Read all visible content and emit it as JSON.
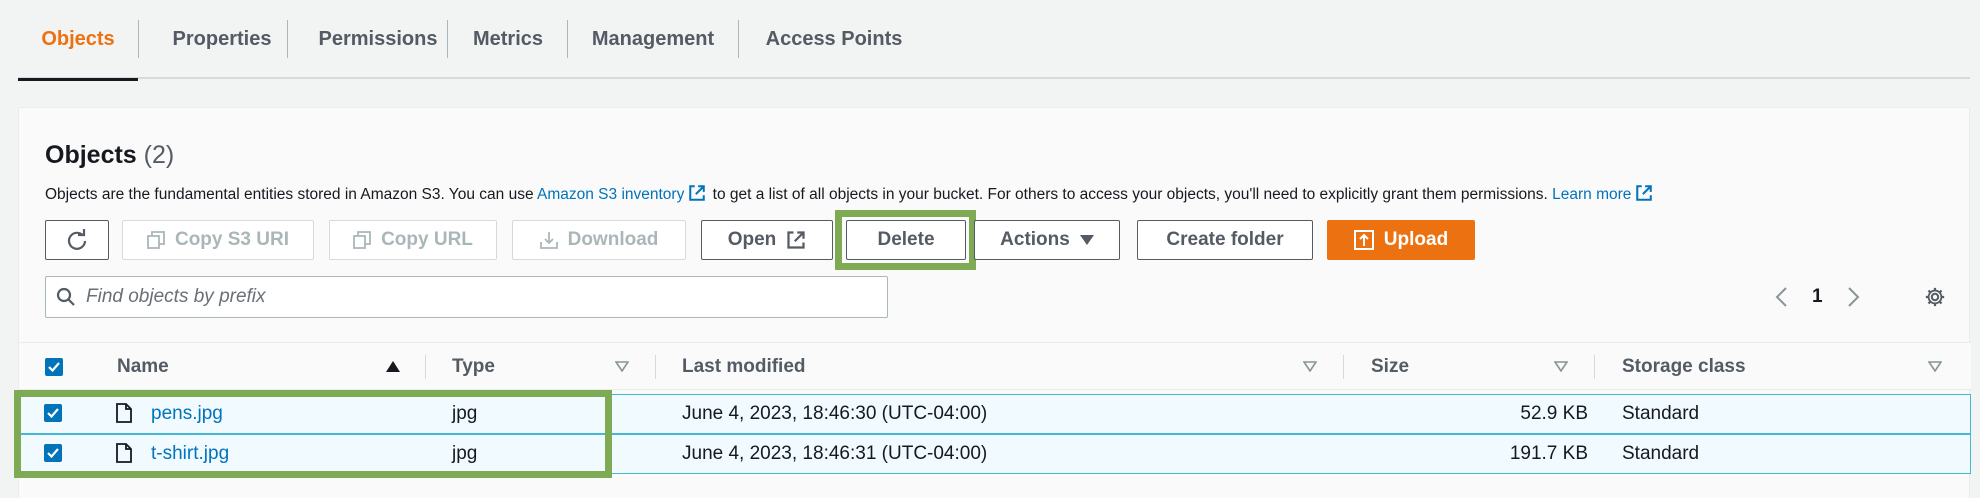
{
  "tabs": [
    {
      "label": "Objects",
      "active": true
    },
    {
      "label": "Properties",
      "active": false
    },
    {
      "label": "Permissions",
      "active": false
    },
    {
      "label": "Metrics",
      "active": false
    },
    {
      "label": "Management",
      "active": false
    },
    {
      "label": "Access Points",
      "active": false
    }
  ],
  "panel": {
    "title": "Objects",
    "count": "(2)",
    "description": {
      "prefix": "Objects are the fundamental entities stored in Amazon S3. You can use ",
      "inventory_link": "Amazon S3 inventory",
      "middle": " to get a list of all objects in your bucket. For others to access your objects, you'll need to explicitly grant them permissions. ",
      "learn_more_link": "Learn more"
    }
  },
  "toolbar": {
    "refresh_icon": "refresh-icon",
    "copy_s3_uri": "Copy S3 URI",
    "copy_url": "Copy URL",
    "download": "Download",
    "open": "Open",
    "delete": "Delete",
    "actions": "Actions",
    "create_folder": "Create folder",
    "upload": "Upload"
  },
  "search": {
    "placeholder": "Find objects by prefix",
    "value": ""
  },
  "pagination": {
    "current_page": "1"
  },
  "table": {
    "columns": [
      "Name",
      "Type",
      "Last modified",
      "Size",
      "Storage class"
    ],
    "rows": [
      {
        "name": "pens.jpg",
        "type": "jpg",
        "last_modified": "June 4, 2023, 18:46:30 (UTC-04:00)",
        "size": "52.9 KB",
        "storage_class": "Standard",
        "selected": true
      },
      {
        "name": "t-shirt.jpg",
        "type": "jpg",
        "last_modified": "June 4, 2023, 18:46:31 (UTC-04:00)",
        "size": "191.7 KB",
        "storage_class": "Standard",
        "selected": true
      }
    ]
  },
  "colors": {
    "accent": "#ec7211",
    "link": "#0073bb",
    "highlight": "#7daa52",
    "selected_row_bg": "#f1faff",
    "selected_row_border": "#44b9d6"
  }
}
